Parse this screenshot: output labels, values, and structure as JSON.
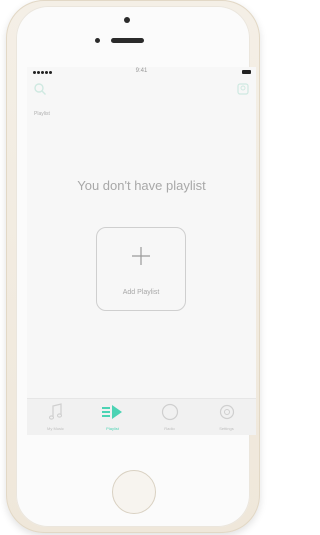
{
  "status_bar": {
    "time": "9:41"
  },
  "nav": {
    "search_icon": "search-icon",
    "profile_icon": "profile-icon"
  },
  "page": {
    "label": "Playlist",
    "empty_message": "You don't have playlist"
  },
  "add_card": {
    "label": "Add Playlist"
  },
  "tabs": [
    {
      "label": "My Music",
      "icon": "music-note-icon",
      "active": false
    },
    {
      "label": "Playlist",
      "icon": "playlist-play-icon",
      "active": true
    },
    {
      "label": "Radio",
      "icon": "radio-icon",
      "active": false
    },
    {
      "label": "Settings",
      "icon": "settings-icon",
      "active": false
    }
  ],
  "colors": {
    "accent": "#4cd3b4",
    "text_muted": "#a8a8a8",
    "phone_frame": "#f4efe6"
  }
}
